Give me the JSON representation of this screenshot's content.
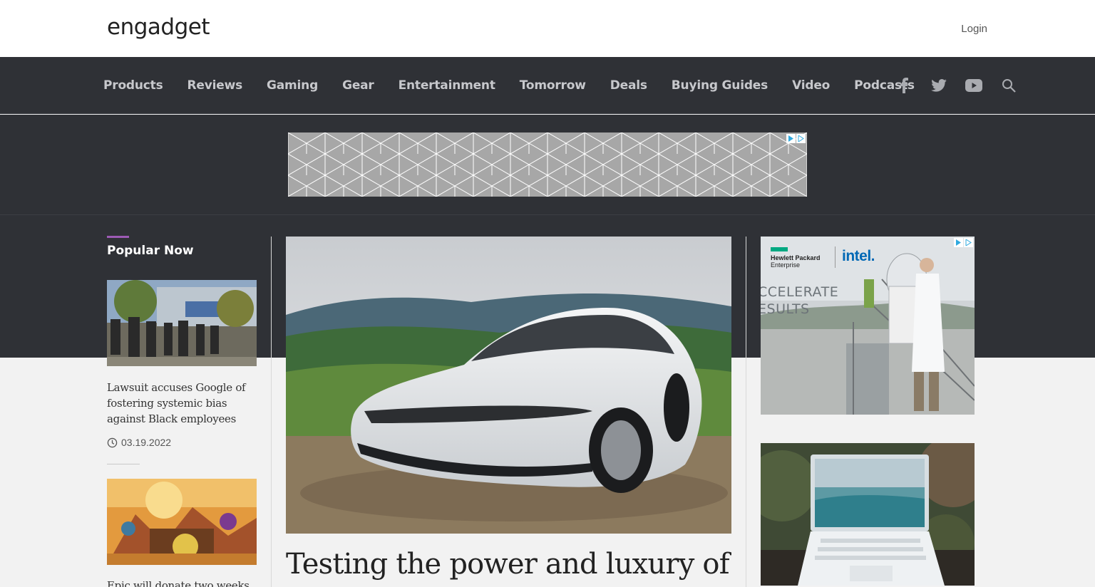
{
  "header": {
    "logo_text": "engadget",
    "login_label": "Login"
  },
  "nav": {
    "items": [
      {
        "label": "Products"
      },
      {
        "label": "Reviews"
      },
      {
        "label": "Gaming"
      },
      {
        "label": "Gear"
      },
      {
        "label": "Entertainment"
      },
      {
        "label": "Tomorrow"
      },
      {
        "label": "Deals"
      },
      {
        "label": "Buying Guides"
      },
      {
        "label": "Video"
      },
      {
        "label": "Podcasts"
      }
    ],
    "icons": [
      "facebook-icon",
      "twitter-icon",
      "youtube-icon",
      "search-icon"
    ]
  },
  "popular": {
    "title": "Popular Now",
    "items": [
      {
        "headline": "Lawsuit accuses Google of fostering systemic bias against Black employees",
        "date": "03.19.2022"
      },
      {
        "headline": "Epic will donate two weeks of"
      }
    ]
  },
  "hero": {
    "headline": "Testing the power and luxury of"
  },
  "side_ad": {
    "brand_hpe_line1": "Hewlett Packard",
    "brand_hpe_line2": "Enterprise",
    "brand_intel": "intel.",
    "slogan_line1": "CCELERATE",
    "slogan_line2": "ESULTS"
  },
  "colors": {
    "nav_bg": "#2f3136",
    "nav_text": "#c7c8cc",
    "accent": "#9d5ab5",
    "page_bg": "#f2f2f2"
  }
}
